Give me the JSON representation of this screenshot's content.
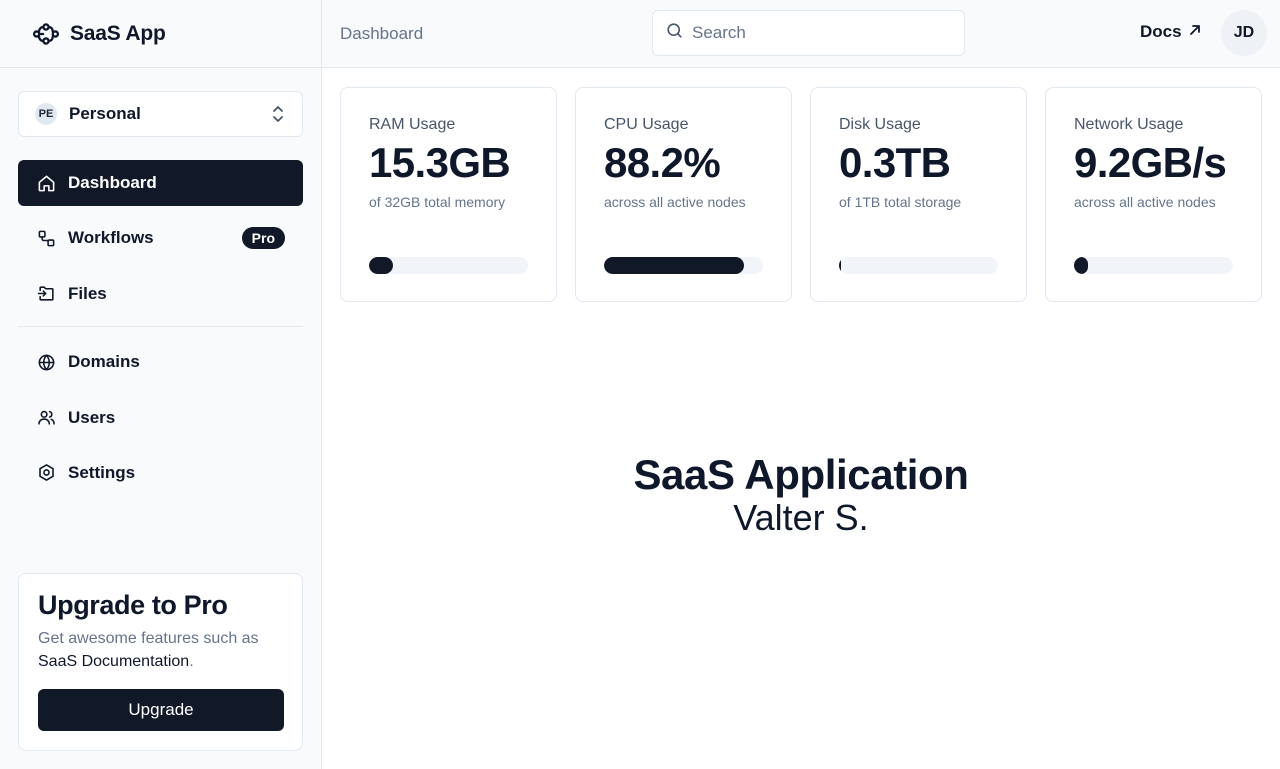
{
  "brand": {
    "name": "SaaS App",
    "icon": "workflow-logo-icon"
  },
  "team": {
    "initials": "PE",
    "name": "Personal"
  },
  "nav": {
    "primary": [
      {
        "label": "Dashboard",
        "icon": "home-icon",
        "active": true
      },
      {
        "label": "Workflows",
        "icon": "workflow-icon",
        "badge": "Pro"
      },
      {
        "label": "Files",
        "icon": "file-import-icon"
      }
    ],
    "secondary": [
      {
        "label": "Domains",
        "icon": "globe-icon"
      },
      {
        "label": "Users",
        "icon": "users-icon"
      },
      {
        "label": "Settings",
        "icon": "settings-icon"
      }
    ]
  },
  "upgrade": {
    "title": "Upgrade to Pro",
    "text_prefix": "Get awesome features such as",
    "text_link": "SaaS Documentation",
    "text_suffix": ".",
    "button": "Upgrade"
  },
  "header": {
    "breadcrumb": "Dashboard",
    "search_placeholder": "Search",
    "docs_label": "Docs",
    "user_initials": "JD"
  },
  "cards": [
    {
      "label": "RAM Usage",
      "value": "15.3GB",
      "sub": "of 32GB total memory",
      "progress": 0.15
    },
    {
      "label": "CPU Usage",
      "value": "88.2%",
      "sub": "across all active nodes",
      "progress": 0.882
    },
    {
      "label": "Disk Usage",
      "value": "0.3TB",
      "sub": "of 1TB total storage",
      "progress": 0.01
    },
    {
      "label": "Network Usage",
      "value": "9.2GB/s",
      "sub": "across all active nodes",
      "progress": 0.09
    }
  ],
  "main": {
    "title": "SaaS Application",
    "subtitle": "Valter S."
  },
  "colors": {
    "primary": "#111827",
    "muted": "#64748b",
    "border": "#e2e8f0",
    "surface": "#f8fafc"
  }
}
